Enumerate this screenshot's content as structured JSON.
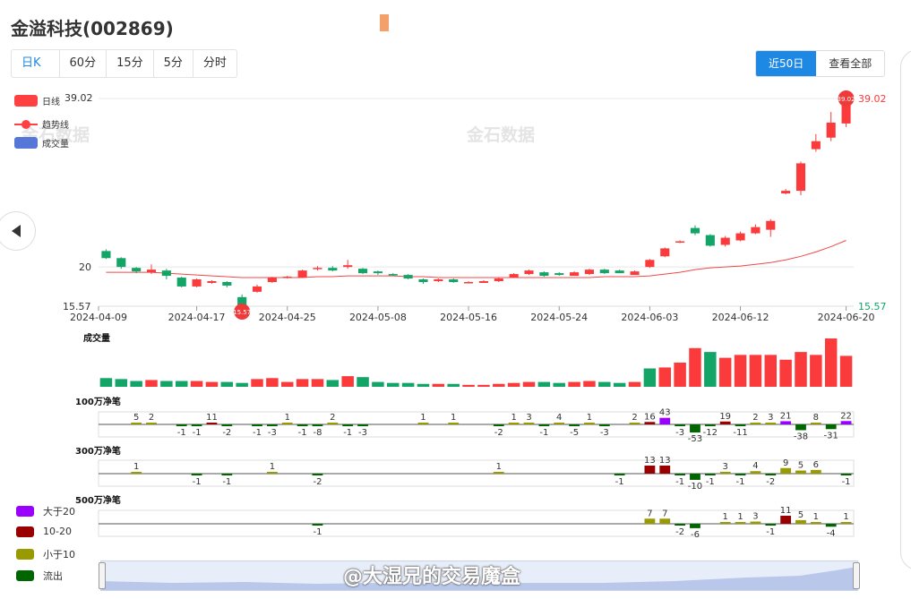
{
  "header": {
    "title": "金溢科技(002869)"
  },
  "period_tabs": [
    "日K",
    "60分",
    "15分",
    "5分",
    "分时"
  ],
  "range_buttons": [
    "近50日",
    "查看全部"
  ],
  "legend": {
    "kline": "日线",
    "kline_value": "39.02",
    "trend": "趋势线",
    "volume": "成交量"
  },
  "flow_legend": {
    "gt20": "大于20",
    "b10_20": "10-20",
    "lt10": "小于10",
    "out": "流出"
  },
  "watermark": "金石数据",
  "weibo": "@大湿兄的交易魔盒",
  "price_axis": {
    "high": "39.02",
    "low": "15.57",
    "mid": "20"
  },
  "panels": {
    "volume": "成交量",
    "p100": "100万净笔",
    "p300": "300万净笔",
    "p500": "500万净笔"
  },
  "colors": {
    "up": "#fb3b3b",
    "down": "#12a567",
    "accent": "#1e88e5",
    "gt20": "#9900ff",
    "b10_20": "#990000",
    "lt10": "#999900",
    "out": "#006600"
  },
  "chart_data": [
    {
      "type": "candlestick",
      "x_ticks": [
        "2024-04-09",
        "2024-04-17",
        "2024-04-25",
        "2024-05-08",
        "2024-05-16",
        "2024-05-24",
        "2024-06-03",
        "2024-06-12",
        "2024-06-20"
      ],
      "ylim": [
        15.57,
        39.02
      ],
      "candles": [
        [
          21.8,
          21.0,
          22.0,
          20.9
        ],
        [
          21.0,
          20.0,
          21.1,
          19.8
        ],
        [
          19.9,
          19.5,
          20.0,
          19.3
        ],
        [
          19.4,
          19.7,
          20.3,
          19.2
        ],
        [
          19.6,
          19.0,
          19.8,
          18.6
        ],
        [
          18.8,
          17.8,
          18.9,
          17.7
        ],
        [
          17.8,
          18.6,
          18.7,
          17.7
        ],
        [
          18.2,
          18.4,
          18.5,
          18.1
        ],
        [
          18.3,
          17.9,
          18.4,
          17.7
        ],
        [
          16.6,
          15.7,
          16.9,
          15.57
        ],
        [
          17.2,
          17.8,
          18.0,
          17.1
        ],
        [
          18.3,
          18.8,
          18.9,
          18.2
        ],
        [
          18.8,
          18.9,
          19.0,
          18.7
        ],
        [
          18.8,
          19.6,
          19.7,
          18.8
        ],
        [
          19.8,
          19.9,
          20.1,
          19.6
        ],
        [
          19.9,
          19.6,
          20.1,
          19.5
        ],
        [
          20.0,
          20.2,
          20.8,
          19.8
        ],
        [
          19.8,
          19.3,
          19.9,
          19.2
        ],
        [
          19.5,
          19.3,
          19.6,
          19.1
        ],
        [
          19.2,
          19.1,
          19.3,
          19.0
        ],
        [
          19.1,
          18.7,
          19.2,
          18.6
        ],
        [
          18.6,
          18.3,
          18.7,
          18.1
        ],
        [
          18.4,
          18.6,
          18.7,
          18.3
        ],
        [
          18.6,
          18.3,
          18.7,
          18.2
        ],
        [
          18.2,
          18.3,
          18.4,
          18.2
        ],
        [
          18.2,
          18.4,
          18.5,
          18.2
        ],
        [
          18.4,
          18.7,
          18.8,
          18.3
        ],
        [
          18.8,
          19.2,
          19.3,
          18.8
        ],
        [
          19.2,
          19.6,
          19.7,
          19.1
        ],
        [
          19.4,
          19.0,
          19.5,
          18.9
        ],
        [
          19.3,
          19.1,
          19.4,
          19.0
        ],
        [
          19.0,
          19.4,
          19.5,
          19.0
        ],
        [
          19.2,
          19.7,
          19.8,
          19.1
        ],
        [
          19.7,
          19.3,
          19.8,
          19.2
        ],
        [
          19.6,
          19.3,
          19.7,
          19.3
        ],
        [
          19.1,
          19.5,
          19.6,
          19.1
        ],
        [
          20.0,
          20.8,
          20.9,
          19.9
        ],
        [
          21.2,
          22.1,
          22.2,
          21.1
        ],
        [
          22.8,
          22.9,
          23.0,
          22.7
        ],
        [
          24.4,
          23.8,
          24.7,
          23.6
        ],
        [
          23.6,
          22.4,
          23.7,
          22.3
        ],
        [
          22.5,
          23.3,
          23.5,
          22.3
        ],
        [
          23.0,
          23.8,
          24.0,
          22.9
        ],
        [
          23.8,
          24.5,
          24.8,
          23.7
        ],
        [
          24.2,
          25.2,
          25.4,
          23.4
        ],
        [
          28.3,
          28.6,
          28.8,
          28.2
        ],
        [
          28.6,
          31.7,
          31.9,
          28.1
        ],
        [
          33.3,
          34.2,
          35.0,
          33.0
        ],
        [
          34.6,
          36.3,
          37.5,
          34.2
        ],
        [
          36.2,
          38.8,
          39.02,
          35.8
        ]
      ],
      "trend": [
        19.4,
        19.4,
        19.4,
        19.4,
        19.3,
        19.2,
        19.1,
        19.0,
        18.9,
        18.8,
        18.8,
        18.8,
        18.8,
        18.8,
        18.9,
        18.9,
        19.0,
        19.0,
        19.0,
        19.0,
        18.9,
        18.9,
        18.8,
        18.8,
        18.8,
        18.8,
        18.8,
        18.8,
        18.8,
        18.8,
        18.8,
        18.8,
        18.8,
        18.9,
        18.9,
        18.9,
        19.0,
        19.2,
        19.4,
        19.7,
        19.9,
        20.0,
        20.1,
        20.3,
        20.5,
        20.8,
        21.2,
        21.7,
        22.3,
        23.0
      ]
    },
    {
      "type": "bar",
      "name": "成交量",
      "values": [
        9,
        8,
        6,
        7,
        6,
        6,
        6,
        5,
        5,
        4,
        8,
        9,
        5,
        8,
        8,
        7,
        11,
        10,
        5,
        4,
        4,
        3,
        3,
        3,
        2,
        2,
        3,
        4,
        5,
        5,
        4,
        5,
        6,
        5,
        4,
        5,
        19,
        20,
        25,
        40,
        36,
        30,
        33,
        33,
        33,
        28,
        36,
        33,
        50,
        32
      ],
      "up": [
        false,
        false,
        false,
        true,
        false,
        false,
        true,
        true,
        false,
        false,
        true,
        true,
        true,
        true,
        true,
        false,
        true,
        false,
        false,
        false,
        false,
        false,
        true,
        false,
        true,
        true,
        true,
        true,
        true,
        false,
        false,
        true,
        true,
        false,
        false,
        true,
        false,
        true,
        true,
        true,
        false,
        true,
        true,
        true,
        true,
        true,
        true,
        true,
        true,
        true
      ]
    },
    {
      "type": "bar",
      "name": "100万净笔",
      "values": [
        0,
        0,
        5,
        2,
        0,
        -1,
        -1,
        11,
        -2,
        0,
        -1,
        -3,
        1,
        -1,
        -8,
        2,
        -1,
        -3,
        0,
        0,
        0,
        1,
        0,
        1,
        0,
        0,
        -2,
        1,
        3,
        -1,
        4,
        -5,
        1,
        -3,
        0,
        2,
        16,
        43,
        -3,
        -53,
        -12,
        19,
        -11,
        2,
        3,
        21,
        -38,
        8,
        -31,
        22
      ],
      "labels_shown": [
        "5",
        "2",
        "-1",
        "-1",
        "11",
        "-2",
        "-1",
        "-3",
        "1",
        "-1",
        "-8",
        "2",
        "-1",
        "-3",
        "1",
        "1",
        "-2",
        "1",
        "3",
        "-1",
        "4",
        "-5",
        "1",
        "-3",
        "2",
        "16",
        "43",
        "-31",
        "-53",
        "-12",
        "19",
        "-11",
        "2",
        "3",
        "21",
        "-38",
        "8",
        "-31",
        "22"
      ]
    },
    {
      "type": "bar",
      "name": "300万净笔",
      "values": [
        0,
        0,
        1,
        0,
        0,
        0,
        -1,
        0,
        -1,
        0,
        0,
        1,
        0,
        0,
        -2,
        0,
        0,
        0,
        0,
        0,
        0,
        0,
        0,
        0,
        0,
        0,
        1,
        0,
        0,
        0,
        0,
        0,
        0,
        0,
        -1,
        0,
        13,
        13,
        -1,
        -10,
        -1,
        3,
        -1,
        4,
        -2,
        9,
        5,
        6,
        0,
        -1
      ]
    },
    {
      "type": "bar",
      "name": "500万净笔",
      "values": [
        0,
        0,
        0,
        0,
        0,
        0,
        0,
        0,
        0,
        0,
        0,
        0,
        0,
        0,
        -1,
        0,
        0,
        0,
        0,
        0,
        0,
        0,
        0,
        0,
        0,
        0,
        0,
        0,
        0,
        0,
        0,
        0,
        0,
        0,
        0,
        0,
        7,
        7,
        -2,
        -6,
        0,
        1,
        1,
        3,
        -1,
        11,
        5,
        1,
        -4,
        1
      ]
    }
  ]
}
